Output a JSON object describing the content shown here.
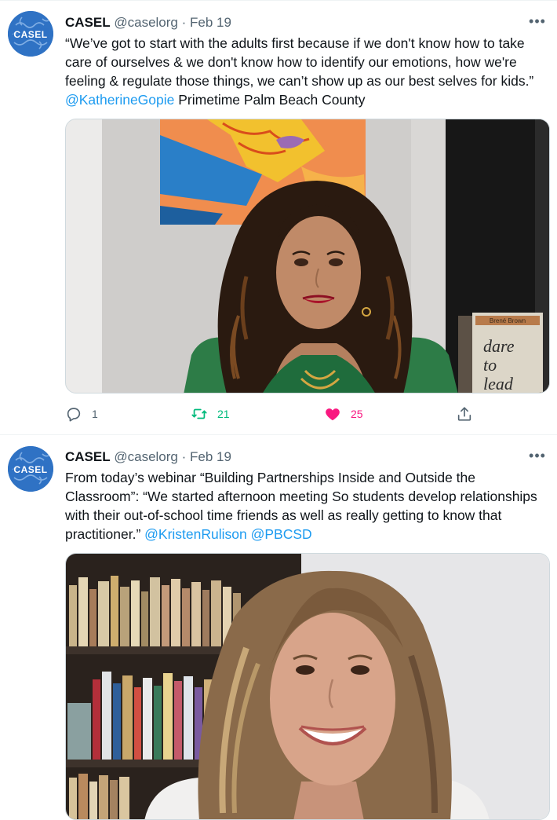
{
  "tweets": [
    {
      "author_name": "CASEL",
      "handle": "@caselorg",
      "separator": "·",
      "date": "Feb 19",
      "avatar_text": "CASEL",
      "more_label": "•••",
      "text_segments": [
        "“We’ve got to start with the adults first because if we don't know how to take care of ourselves & we don't know how to identify our emotions, how we're feeling & regulate those things, we can’t show up as our best selves for kids.” ",
        "@KatherineGopie",
        " Primetime Palm Beach County"
      ],
      "book_lines": [
        "dare",
        "to",
        "lead"
      ],
      "book_author": "Brené Brown",
      "stats": {
        "replies": "1",
        "retweets": "21",
        "likes": "25"
      }
    },
    {
      "author_name": "CASEL",
      "handle": "@caselorg",
      "separator": "·",
      "date": "Feb 19",
      "avatar_text": "CASEL",
      "more_label": "•••",
      "text_segments": [
        "From today’s webinar “Building Partnerships Inside and Outside the Classroom”: “We started afternoon meeting So students develop relationships with their out-of-school time friends as well as really getting to know that practitioner.” ",
        "@KristenRulison",
        " ",
        "@PBCSD"
      ]
    }
  ],
  "colors": {
    "accent": "#1d9bf0",
    "retweet": "#00ba7c",
    "like": "#f91880",
    "muted": "#536471",
    "brand": "#2f72c4"
  },
  "icons": {
    "reply": "comment-bubble-icon",
    "retweet": "retweet-arrows-icon",
    "like": "heart-icon",
    "share": "share-upload-icon"
  }
}
